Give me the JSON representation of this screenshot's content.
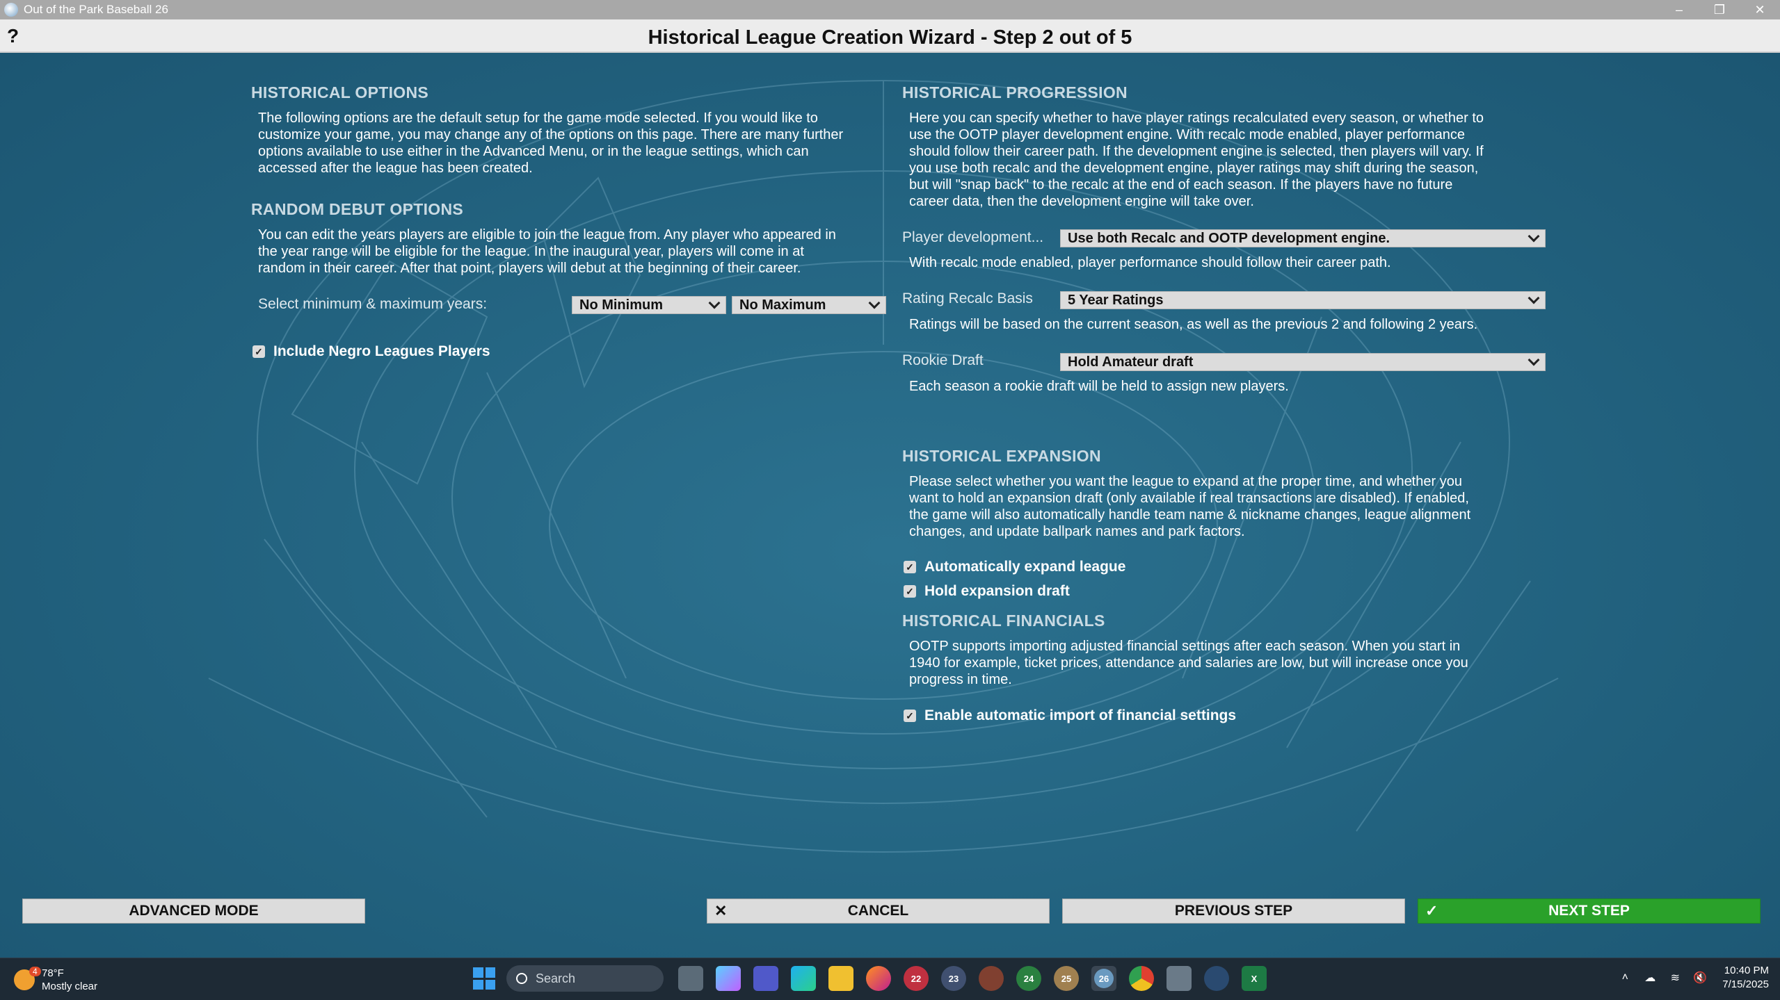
{
  "window": {
    "title": "Out of the Park Baseball 26",
    "controls": [
      "minimize-icon",
      "restore-icon",
      "close-icon"
    ]
  },
  "header": {
    "help": "?",
    "title": "Historical League Creation Wizard - Step 2 out of 5"
  },
  "historical_options": {
    "title": "HISTORICAL OPTIONS",
    "lines": [
      "The following options are the default setup for the game mode selected. If you would like to",
      "customize your game, you may change any of the options on this page. There are many further",
      "options available to use either in the Advanced Menu, or in the league settings, which can",
      "accessed after the league has been created."
    ]
  },
  "random_debut": {
    "title": "RANDOM DEBUT OPTIONS",
    "lines": [
      "You can edit the years players are eligible to join the league from. Any player who appeared in",
      "the year range will be eligible for the league. In the inaugural year, players will come in at",
      "random in their career. After that point, players will debut at the beginning of their career."
    ],
    "years_label": "Select minimum & maximum years:",
    "min_value": "No Minimum",
    "max_value": "No Maximum",
    "negro_leagues_label": "Include Negro Leagues Players",
    "negro_leagues_checked": true
  },
  "historical_progression": {
    "title": "HISTORICAL PROGRESSION",
    "lines": [
      "Here you can specify whether to have player ratings recalculated every season, or whether to",
      "use the OOTP player development engine. With recalc mode enabled, player performance",
      "should follow their career path. If the development engine is selected, then players will vary. If",
      "you use both recalc and the development engine, player ratings may shift during the season,",
      "but will \"snap back\" to the recalc at the end of each season. If the players have no future",
      "career data, then the development engine will take over."
    ],
    "player_dev_label": "Player development...",
    "player_dev_value": "Use both Recalc and OOTP development engine.",
    "player_dev_note": "With recalc mode enabled, player performance should follow their career path.",
    "recalc_label": "Rating Recalc Basis",
    "recalc_value": "5 Year Ratings",
    "recalc_note": "Ratings will be based on the current season, as well as the previous 2 and following 2 years.",
    "rookie_label": "Rookie Draft",
    "rookie_value": "Hold Amateur draft",
    "rookie_note": "Each season a rookie draft will be held to assign new players."
  },
  "historical_expansion": {
    "title": "HISTORICAL EXPANSION",
    "lines": [
      "Please select whether you want the league to expand at the proper time, and whether you",
      "want to hold an expansion draft (only available if real transactions are disabled). If enabled,",
      "the game will also automatically handle team name & nickname changes, league alignment",
      "changes, and update ballpark names and park factors."
    ],
    "auto_expand_label": "Automatically expand league",
    "auto_expand_checked": true,
    "expansion_draft_label": "Hold expansion draft",
    "expansion_draft_checked": true
  },
  "historical_financials": {
    "title": "HISTORICAL FINANCIALS",
    "lines": [
      "OOTP supports importing adjusted financial settings after each season. When you start in",
      "1940 for example, ticket prices, attendance and salaries are low, but will increase once you",
      "progress in time."
    ],
    "auto_import_label": "Enable automatic import of financial settings",
    "auto_import_checked": true
  },
  "buttons": {
    "advanced": "ADVANCED MODE",
    "cancel": "CANCEL",
    "previous": "PREVIOUS STEP",
    "next": "NEXT STEP"
  },
  "taskbar": {
    "weather_badge": "4",
    "temperature": "78°F",
    "condition": "Mostly clear",
    "search_placeholder": "Search",
    "time": "10:40 PM",
    "date": "7/15/2025",
    "apps": [
      "task-view-icon",
      "copilot-icon",
      "teams-icon",
      "edge-icon",
      "file-explorer-icon",
      "firefox-icon",
      "ootp-22-icon",
      "ootp-23-icon",
      "game-icon",
      "ootp-24-icon",
      "ootp-25-icon",
      "ootp-26-icon",
      "chrome-icon",
      "calculator-icon",
      "steam-icon",
      "excel-icon"
    ],
    "app_labels": [
      "",
      "",
      "",
      "",
      "",
      "",
      "22",
      "23",
      "",
      "24",
      "25",
      "26",
      "",
      "",
      "",
      "X"
    ],
    "colors": {
      "accent": "#3aa0f0",
      "next_green": "#2aa12a"
    }
  }
}
